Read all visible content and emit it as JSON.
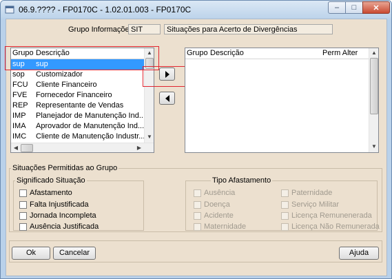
{
  "window": {
    "title": "06.9.???? - FP0170C - 1.02.01.003 - FP0170C",
    "controls": {
      "minimize": "–",
      "maximize": "□",
      "close": "✕"
    }
  },
  "group_info": {
    "label": "Grupo Informações:",
    "code": "SIT",
    "description": "Situações para Acerto de Divergências"
  },
  "left_list": {
    "headers": {
      "grupo": "Grupo",
      "descricao": "Descrição"
    },
    "rows": [
      {
        "grupo": "sup",
        "descricao": "sup",
        "selected": true
      },
      {
        "grupo": "sop",
        "descricao": "Customizador"
      },
      {
        "grupo": "FCU",
        "descricao": "Cliente Financeiro"
      },
      {
        "grupo": "FVE",
        "descricao": "Fornecedor Financeiro"
      },
      {
        "grupo": "REP",
        "descricao": "Representante de Vendas"
      },
      {
        "grupo": "IMP",
        "descricao": "Planejador de Manutenção Ind..."
      },
      {
        "grupo": "IMA",
        "descricao": "Aprovador de Manutenção Ind..."
      },
      {
        "grupo": "IMC",
        "descricao": "Cliente de Manutenção Industr..."
      }
    ]
  },
  "right_list": {
    "headers": {
      "grupo": "Grupo",
      "descricao": "Descrição",
      "perm_alter": "Perm Alter"
    },
    "rows": []
  },
  "allowed_section": {
    "legend": "Situações Permitidas ao Grupo",
    "significado": {
      "legend": "Significado Situação",
      "items": [
        "Afastamento",
        "Falta Injustificada",
        "Jornada Incompleta",
        "Ausência Justificada"
      ]
    },
    "tipo_afastamento": {
      "legend": "Tipo Afastamento",
      "col1": [
        "Ausência",
        "Doença",
        "Acidente",
        "Maternidade"
      ],
      "col2": [
        "Paternidade",
        "Serviço Militar",
        "Licença Remunenerada",
        "Licença Não Remunerada"
      ]
    }
  },
  "buttons": {
    "ok": "Ok",
    "cancel": "Cancelar",
    "help": "Ajuda"
  },
  "colors": {
    "selection": "#3399ff",
    "highlight_box": "#e0242f",
    "dialog_bg": "#ece0cf"
  }
}
